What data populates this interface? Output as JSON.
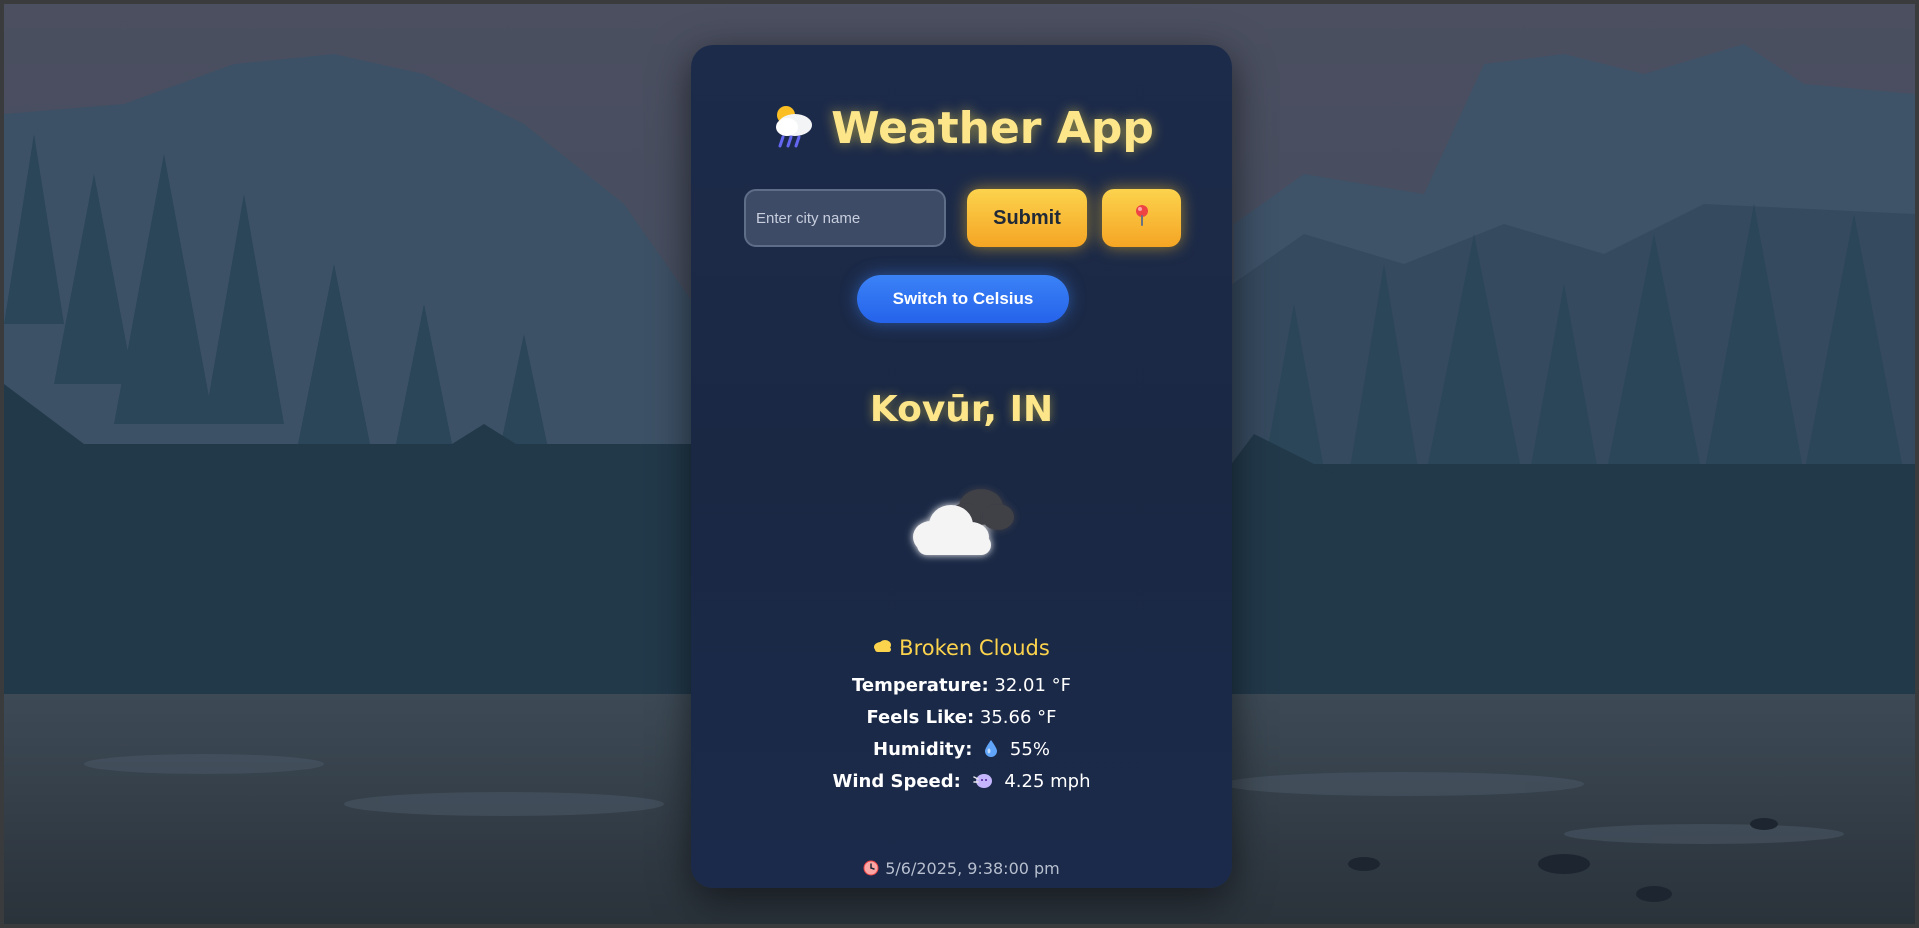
{
  "app": {
    "title": "Weather App",
    "title_icon": "sun-behind-rain-cloud-icon"
  },
  "search": {
    "placeholder": "Enter city name",
    "value": "",
    "submit_label": "Submit",
    "location_icon": "location-pin-icon"
  },
  "units": {
    "toggle_label": "Switch to Celsius"
  },
  "weather": {
    "city": "Kovūr, IN",
    "icon": "broken-clouds-icon",
    "condition": "Broken Clouds",
    "condition_icon": "cloud-icon",
    "temperature_label": "Temperature:",
    "temperature_value": "32.01 °F",
    "feels_like_label": "Feels Like:",
    "feels_like_value": "35.66 °F",
    "humidity_label": "Humidity:",
    "humidity_icon": "droplet-icon",
    "humidity_value": "55%",
    "wind_label": "Wind Speed:",
    "wind_icon": "wind-face-icon",
    "wind_value": "4.25 mph",
    "time_icon": "clock-icon",
    "timestamp": "5/6/2025, 9:38:00 pm"
  },
  "colors": {
    "accent_yellow": "#fde68a",
    "button_yellow": "#fbbf24",
    "button_blue": "#3b82f6",
    "card_bg": "#1c2a48"
  }
}
